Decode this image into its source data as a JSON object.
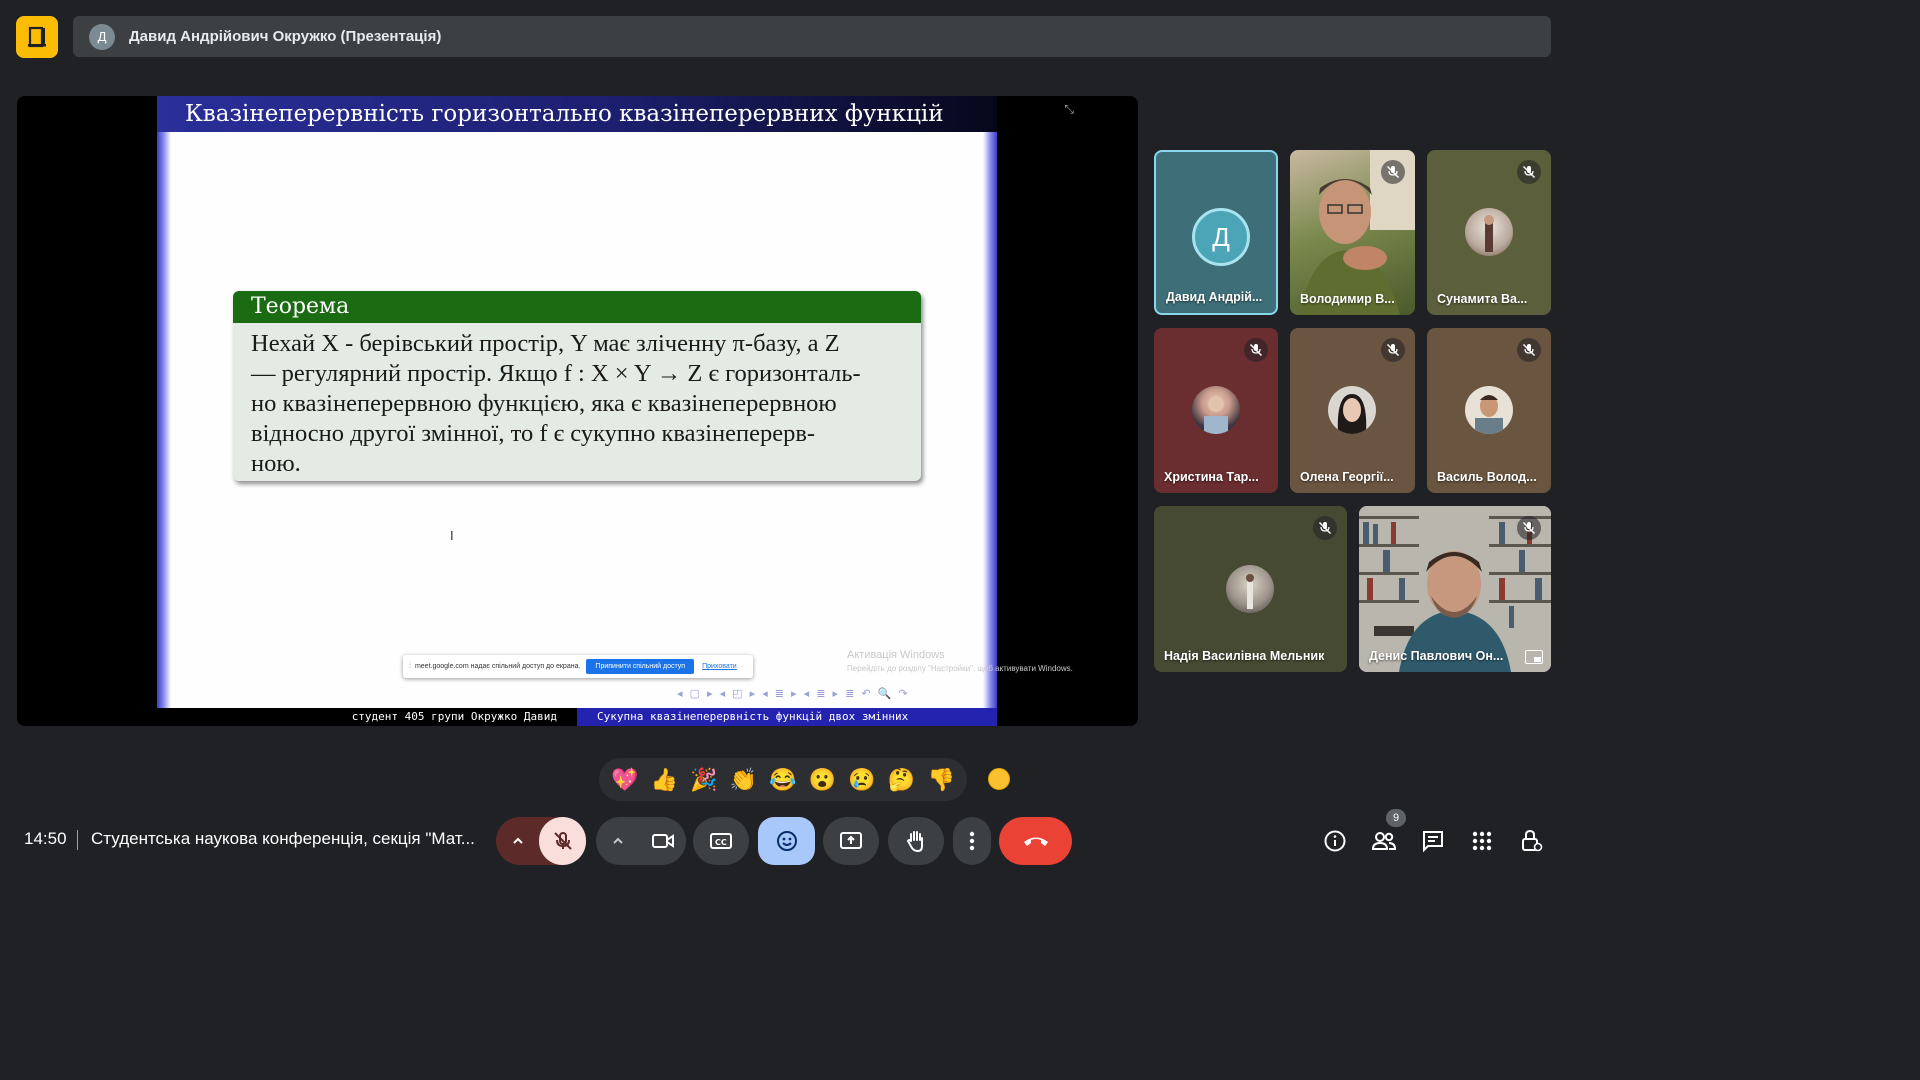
{
  "app": {
    "logo_glyph": "Д",
    "accent": "#fbbc04"
  },
  "presenter_bar": {
    "avatar_letter": "Д",
    "title": "Давид Андрійович Окружко (Презентація)"
  },
  "slide": {
    "header": "Квазінеперервність горизонтально квазінеперервних функцій",
    "theorem_title": "Теорема",
    "theorem_line1": "Нехай X - берівський простір, Y має зліченну π-базу, а Z",
    "theorem_line2": "— регулярний простір. Якщо f : X × Y → Z є горизонталь-",
    "theorem_line3": "но квазінеперервною функцією, яка є квазінеперервною",
    "theorem_line4": "відносно другої змінної, то f є сукупно квазінеперерв-",
    "theorem_line5": "ною.",
    "footer_left": "студент 405 групи Окружко Давид",
    "footer_right": "Сукупна квазінеперервність функцій двох змінних",
    "nav_symbols": "◂ ▢ ▸ ◂ ◰ ▸ ◂ ≣ ▸ ◂ ≣ ▸ ≣ ↶ 🔍 ↷"
  },
  "share_bar": {
    "text": "meet.google.com надає спільний доступ до екрана.",
    "stop_label": "Припинити спільний доступ",
    "hide_label": "Приховати"
  },
  "windows_activation": {
    "line1": "Активація Windows",
    "line2": "Перейдіть до розділу \"Настройки\", щоб активувати Windows."
  },
  "participants": [
    {
      "name": "Давид Андрій...",
      "letter": "Д",
      "active_speaker": true
    },
    {
      "name": "Володимир В...",
      "muted": true
    },
    {
      "name": "Сунамита Ва...",
      "muted": true
    },
    {
      "name": "Христина Тар...",
      "muted": true
    },
    {
      "name": "Олена Георгії...",
      "muted": true
    },
    {
      "name": "Василь Волод...",
      "muted": true
    },
    {
      "name": "Надія Василівна Мельник",
      "muted": true
    },
    {
      "name": "Денис Павлович Он...",
      "muted": true
    }
  ],
  "reactions": [
    "💖",
    "👍",
    "🎉",
    "👏",
    "😂",
    "😮",
    "😢",
    "🤔",
    "👎"
  ],
  "bottom_bar": {
    "time": "14:50",
    "meeting_name": "Студентська наукова конференція, секція \"Мат...",
    "people_count": "9"
  },
  "colors": {
    "end_call": "#ea4335",
    "mic_off_bg": "#f9dedc",
    "reaction_active": "#a8c7fa"
  }
}
